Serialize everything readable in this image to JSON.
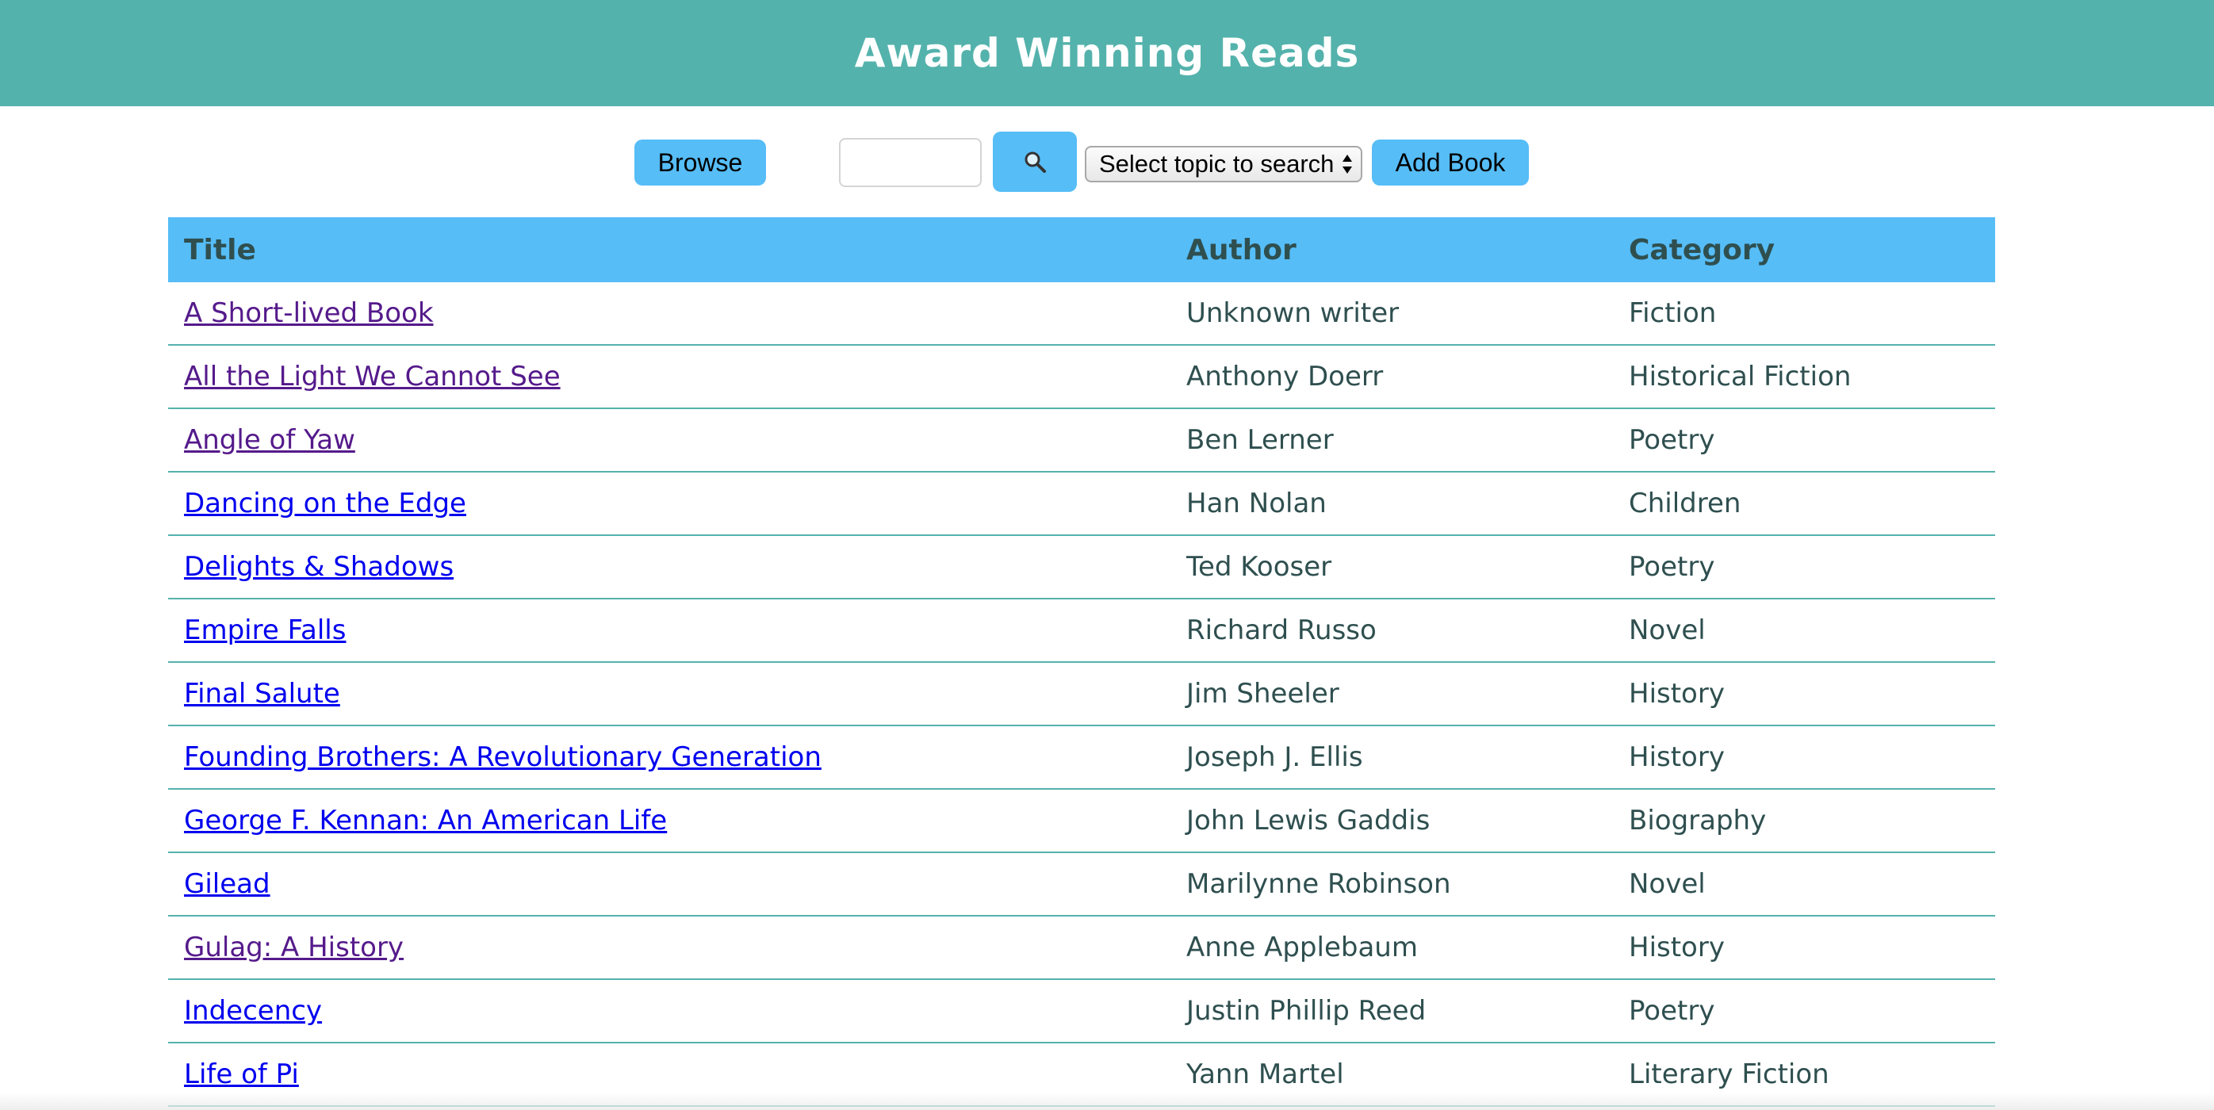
{
  "header": {
    "title": "Award Winning Reads"
  },
  "toolbar": {
    "browse_label": "Browse",
    "search_placeholder": "",
    "search_icon": "magnifying-glass-icon",
    "topic_select_value": "Select topic to search",
    "add_book_label": "Add Book"
  },
  "colors": {
    "header_bg": "#54b2ac",
    "button_bg": "#56bdf7",
    "text": "#2f4f4f",
    "link": "#0000ee",
    "visited_link": "#551a8b"
  },
  "table": {
    "headers": {
      "title": "Title",
      "author": "Author",
      "category": "Category"
    },
    "rows": [
      {
        "title": "A Short-lived Book",
        "author": "Unknown writer",
        "category": "Fiction",
        "visited": true
      },
      {
        "title": "All the Light We Cannot See",
        "author": "Anthony Doerr",
        "category": "Historical Fiction",
        "visited": true
      },
      {
        "title": "Angle of Yaw",
        "author": "Ben Lerner",
        "category": "Poetry",
        "visited": true
      },
      {
        "title": "Dancing on the Edge",
        "author": "Han Nolan",
        "category": "Children",
        "visited": false
      },
      {
        "title": "Delights & Shadows",
        "author": "Ted Kooser",
        "category": "Poetry",
        "visited": false
      },
      {
        "title": "Empire Falls",
        "author": "Richard Russo",
        "category": "Novel",
        "visited": false
      },
      {
        "title": "Final Salute",
        "author": "Jim Sheeler",
        "category": "History",
        "visited": false
      },
      {
        "title": "Founding Brothers: A Revolutionary Generation",
        "author": "Joseph J. Ellis",
        "category": "History",
        "visited": false
      },
      {
        "title": "George F. Kennan: An American Life",
        "author": "John Lewis Gaddis",
        "category": "Biography",
        "visited": false
      },
      {
        "title": "Gilead",
        "author": "Marilynne Robinson",
        "category": "Novel",
        "visited": false
      },
      {
        "title": "Gulag: A History",
        "author": "Anne Applebaum",
        "category": "History",
        "visited": true
      },
      {
        "title": "Indecency",
        "author": "Justin Phillip Reed",
        "category": "Poetry",
        "visited": false
      },
      {
        "title": "Life of Pi",
        "author": "Yann Martel",
        "category": "Literary Fiction",
        "visited": false
      }
    ]
  }
}
